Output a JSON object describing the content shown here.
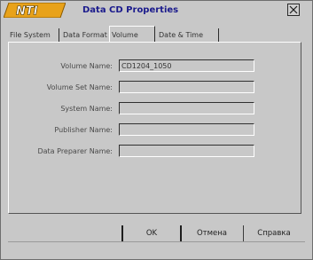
{
  "window": {
    "title": "Data CD Properties",
    "logo_text": "NTI"
  },
  "tabs": [
    {
      "label": "File System"
    },
    {
      "label": "Data Format"
    },
    {
      "label": "Volume"
    },
    {
      "label": "Date & Time"
    }
  ],
  "form": {
    "fields": [
      {
        "label": "Volume Name:",
        "value": "CD1204_1050"
      },
      {
        "label": "Volume Set Name:",
        "value": ""
      },
      {
        "label": "System Name:",
        "value": ""
      },
      {
        "label": "Publisher Name:",
        "value": ""
      },
      {
        "label": "Data Preparer Name:",
        "value": ""
      }
    ]
  },
  "buttons": {
    "ok": "OK",
    "cancel": "Отмена",
    "help": "Справка"
  },
  "colors": {
    "title_text": "#1a1a8c",
    "logo_fill": "#e8a21a",
    "background": "#c8c8c8"
  }
}
